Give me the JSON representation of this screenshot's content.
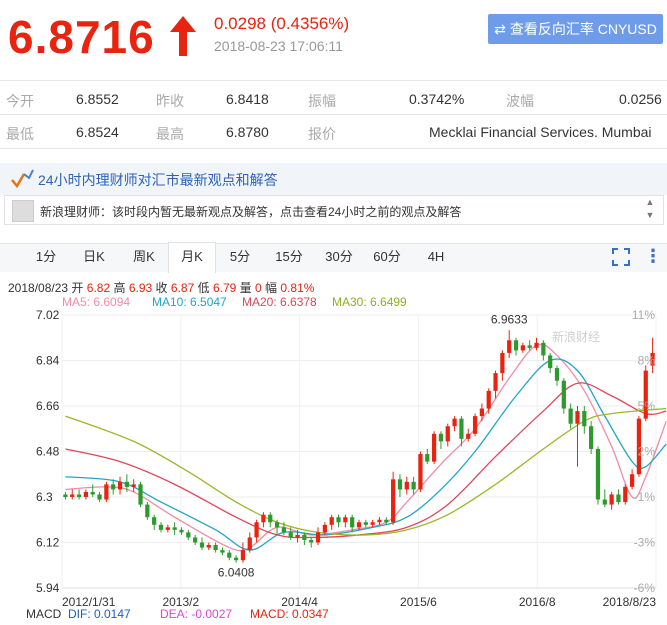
{
  "quote": {
    "price": "6.8716",
    "change": "0.0298 (0.4356%)",
    "datetime": "2018-08-23 17:06:11",
    "reverse_button": "查看反向汇率 CNYUSD",
    "rows": [
      [
        {
          "label": "今开",
          "value": "6.8552"
        },
        {
          "label": "昨收",
          "value": "6.8418"
        },
        {
          "label": "振幅",
          "value": "0.3742%"
        },
        {
          "label": "波幅",
          "value": "0.0256"
        }
      ],
      [
        {
          "label": "最低",
          "value": "6.8524"
        },
        {
          "label": "最高",
          "value": "6.8780"
        },
        {
          "label": "报价",
          "value": "Mecklai Financial Services. Mumbai"
        }
      ]
    ]
  },
  "experts": {
    "title": "24小时内理财师对汇市最新观点和解答",
    "message": "新浪理财师：该时段内暂无最新观点及解答，点击查看24小时之前的观点及解答"
  },
  "tabs": [
    "1分",
    "日K",
    "周K",
    "月K",
    "5分",
    "15分",
    "30分",
    "60分",
    "4H"
  ],
  "active_tab": "月K",
  "kline_info": {
    "date": "2018/08/23",
    "open_label": "开",
    "open": "6.82",
    "high_label": "高",
    "high": "6.93",
    "close_label": "收",
    "close": "6.87",
    "low_label": "低",
    "low": "6.79",
    "vol_label": "量",
    "vol": "0",
    "amp_label": "幅",
    "amp": "0.81%"
  },
  "ma": [
    {
      "label": "MA5: 6.6094",
      "color": "#f08ca6"
    },
    {
      "label": "MA10: 6.5047",
      "color": "#1fa6c6"
    },
    {
      "label": "MA20: 6.6378",
      "color": "#e0455a"
    },
    {
      "label": "MA30: 6.6499",
      "color": "#8db020"
    }
  ],
  "macd": {
    "name": "MACD",
    "dif": "DIF: 0.0147",
    "dea": "DEA: -0.0027",
    "macd": "MACD: 0.0347"
  },
  "chart_data": {
    "type": "candlestick",
    "title": "",
    "watermark": "新浪财经",
    "y_ticks": [
      "7.02",
      "6.84",
      "6.66",
      "6.48",
      "6.3",
      "6.12",
      "5.94"
    ],
    "ylim": [
      5.94,
      7.02
    ],
    "pct_ticks": [
      "11%",
      "8%",
      "5%",
      "2%",
      "-1%",
      "-3%",
      "-6%"
    ],
    "x_ticks": [
      "2012/1/31",
      "2013/2",
      "2014/4",
      "2015/6",
      "2016/8",
      "2018/8/23"
    ],
    "annotations": [
      {
        "text": "6.9633",
        "value": 6.9633
      },
      {
        "text": "6.0408",
        "value": 6.0408
      }
    ],
    "candles": [
      [
        6.31,
        6.3,
        6.32,
        6.29
      ],
      [
        6.3,
        6.31,
        6.33,
        6.29
      ],
      [
        6.31,
        6.3,
        6.33,
        6.29
      ],
      [
        6.3,
        6.32,
        6.33,
        6.29
      ],
      [
        6.32,
        6.31,
        6.35,
        6.3
      ],
      [
        6.31,
        6.29,
        6.32,
        6.28
      ],
      [
        6.29,
        6.35,
        6.36,
        6.28
      ],
      [
        6.35,
        6.33,
        6.37,
        6.31
      ],
      [
        6.33,
        6.36,
        6.38,
        6.31
      ],
      [
        6.36,
        6.34,
        6.39,
        6.32
      ],
      [
        6.34,
        6.35,
        6.37,
        6.32
      ],
      [
        6.35,
        6.27,
        6.36,
        6.26
      ],
      [
        6.27,
        6.22,
        6.28,
        6.21
      ],
      [
        6.22,
        6.19,
        6.23,
        6.17
      ],
      [
        6.19,
        6.17,
        6.2,
        6.16
      ],
      [
        6.17,
        6.18,
        6.19,
        6.16
      ],
      [
        6.18,
        6.17,
        6.2,
        6.15
      ],
      [
        6.17,
        6.16,
        6.18,
        6.15
      ],
      [
        6.16,
        6.14,
        6.17,
        6.13
      ],
      [
        6.14,
        6.12,
        6.15,
        6.11
      ],
      [
        6.12,
        6.1,
        6.14,
        6.09
      ],
      [
        6.1,
        6.11,
        6.12,
        6.09
      ],
      [
        6.11,
        6.09,
        6.12,
        6.08
      ],
      [
        6.09,
        6.08,
        6.1,
        6.07
      ],
      [
        6.08,
        6.06,
        6.09,
        6.05
      ],
      [
        6.06,
        6.05,
        6.07,
        6.04
      ],
      [
        6.05,
        6.09,
        6.12,
        6.04
      ],
      [
        6.09,
        6.14,
        6.16,
        6.08
      ],
      [
        6.14,
        6.2,
        6.21,
        6.12
      ],
      [
        6.2,
        6.23,
        6.24,
        6.18
      ],
      [
        6.23,
        6.2,
        6.24,
        6.18
      ],
      [
        6.2,
        6.18,
        6.21,
        6.15
      ],
      [
        6.18,
        6.16,
        6.2,
        6.15
      ],
      [
        6.16,
        6.14,
        6.18,
        6.13
      ],
      [
        6.14,
        6.15,
        6.17,
        6.12
      ],
      [
        6.15,
        6.13,
        6.16,
        6.11
      ],
      [
        6.13,
        6.12,
        6.14,
        6.1
      ],
      [
        6.12,
        6.16,
        6.18,
        6.11
      ],
      [
        6.16,
        6.19,
        6.2,
        6.15
      ],
      [
        6.19,
        6.22,
        6.23,
        6.17
      ],
      [
        6.22,
        6.2,
        6.23,
        6.18
      ],
      [
        6.2,
        6.22,
        6.23,
        6.18
      ],
      [
        6.22,
        6.18,
        6.23,
        6.16
      ],
      [
        6.18,
        6.2,
        6.21,
        6.17
      ],
      [
        6.2,
        6.19,
        6.21,
        6.18
      ],
      [
        6.19,
        6.2,
        6.21,
        6.18
      ],
      [
        6.2,
        6.21,
        6.22,
        6.19
      ],
      [
        6.21,
        6.2,
        6.22,
        6.19
      ],
      [
        6.2,
        6.37,
        6.4,
        6.19
      ],
      [
        6.37,
        6.33,
        6.39,
        6.3
      ],
      [
        6.33,
        6.36,
        6.38,
        6.31
      ],
      [
        6.36,
        6.33,
        6.38,
        6.31
      ],
      [
        6.33,
        6.47,
        6.48,
        6.32
      ],
      [
        6.47,
        6.44,
        6.49,
        6.43
      ],
      [
        6.44,
        6.55,
        6.56,
        6.43
      ],
      [
        6.55,
        6.52,
        6.56,
        6.49
      ],
      [
        6.52,
        6.58,
        6.59,
        6.5
      ],
      [
        6.58,
        6.61,
        6.62,
        6.56
      ],
      [
        6.61,
        6.53,
        6.62,
        6.5
      ],
      [
        6.53,
        6.55,
        6.57,
        6.52
      ],
      [
        6.55,
        6.62,
        6.63,
        6.54
      ],
      [
        6.62,
        6.65,
        6.67,
        6.6
      ],
      [
        6.65,
        6.72,
        6.73,
        6.63
      ],
      [
        6.72,
        6.79,
        6.8,
        6.69
      ],
      [
        6.79,
        6.87,
        6.88,
        6.76
      ],
      [
        6.87,
        6.92,
        6.96,
        6.85
      ],
      [
        6.92,
        6.88,
        6.93,
        6.86
      ],
      [
        6.88,
        6.9,
        6.91,
        6.87
      ],
      [
        6.9,
        6.89,
        6.92,
        6.88
      ],
      [
        6.89,
        6.91,
        6.93,
        6.88
      ],
      [
        6.91,
        6.86,
        6.92,
        6.84
      ],
      [
        6.86,
        6.81,
        6.87,
        6.79
      ],
      [
        6.81,
        6.76,
        6.82,
        6.74
      ],
      [
        6.76,
        6.65,
        6.77,
        6.63
      ],
      [
        6.65,
        6.59,
        6.67,
        6.57
      ],
      [
        6.59,
        6.64,
        6.66,
        6.42
      ],
      [
        6.64,
        6.58,
        6.66,
        6.55
      ],
      [
        6.58,
        6.49,
        6.6,
        6.47
      ],
      [
        6.49,
        6.29,
        6.5,
        6.27
      ],
      [
        6.29,
        6.27,
        6.33,
        6.26
      ],
      [
        6.27,
        6.31,
        6.32,
        6.25
      ],
      [
        6.31,
        6.28,
        6.33,
        6.27
      ],
      [
        6.28,
        6.34,
        6.35,
        6.27
      ],
      [
        6.34,
        6.39,
        6.41,
        6.33
      ],
      [
        6.39,
        6.61,
        6.62,
        6.38
      ],
      [
        6.61,
        6.8,
        6.82,
        6.6
      ],
      [
        6.82,
        6.87,
        6.93,
        6.79
      ]
    ],
    "ma_series": [
      {
        "name": "MA5",
        "color": "#f08ca6",
        "anchors": [
          [
            0,
            6.33
          ],
          [
            6,
            6.34
          ],
          [
            10,
            6.32
          ],
          [
            16,
            6.22
          ],
          [
            24,
            6.1
          ],
          [
            27,
            6.1
          ],
          [
            31,
            6.18
          ],
          [
            36,
            6.15
          ],
          [
            42,
            6.17
          ],
          [
            47,
            6.2
          ],
          [
            50,
            6.28
          ],
          [
            55,
            6.43
          ],
          [
            60,
            6.57
          ],
          [
            65,
            6.77
          ],
          [
            69,
            6.9
          ],
          [
            72,
            6.86
          ],
          [
            76,
            6.72
          ],
          [
            80,
            6.5
          ],
          [
            83,
            6.3
          ],
          [
            85,
            6.38
          ],
          [
            88,
            6.6
          ]
        ]
      },
      {
        "name": "MA10",
        "color": "#1fa6c6",
        "anchors": [
          [
            0,
            6.38
          ],
          [
            8,
            6.36
          ],
          [
            14,
            6.28
          ],
          [
            22,
            6.17
          ],
          [
            27,
            6.09
          ],
          [
            32,
            6.16
          ],
          [
            38,
            6.15
          ],
          [
            45,
            6.18
          ],
          [
            50,
            6.22
          ],
          [
            55,
            6.33
          ],
          [
            60,
            6.48
          ],
          [
            66,
            6.7
          ],
          [
            71,
            6.84
          ],
          [
            75,
            6.8
          ],
          [
            79,
            6.62
          ],
          [
            83,
            6.44
          ],
          [
            85,
            6.42
          ],
          [
            88,
            6.51
          ]
        ]
      },
      {
        "name": "MA20",
        "color": "#e0455a",
        "anchors": [
          [
            0,
            6.49
          ],
          [
            8,
            6.44
          ],
          [
            16,
            6.35
          ],
          [
            25,
            6.22
          ],
          [
            31,
            6.15
          ],
          [
            36,
            6.14
          ],
          [
            43,
            6.15
          ],
          [
            50,
            6.18
          ],
          [
            56,
            6.27
          ],
          [
            63,
            6.46
          ],
          [
            70,
            6.64
          ],
          [
            75,
            6.75
          ],
          [
            80,
            6.7
          ],
          [
            85,
            6.63
          ],
          [
            88,
            6.64
          ]
        ]
      },
      {
        "name": "MA30",
        "color": "#9ab82a",
        "anchors": [
          [
            0,
            6.62
          ],
          [
            10,
            6.52
          ],
          [
            18,
            6.4
          ],
          [
            25,
            6.28
          ],
          [
            31,
            6.2
          ],
          [
            37,
            6.16
          ],
          [
            44,
            6.15
          ],
          [
            50,
            6.17
          ],
          [
            56,
            6.23
          ],
          [
            63,
            6.35
          ],
          [
            70,
            6.49
          ],
          [
            76,
            6.6
          ],
          [
            80,
            6.63
          ],
          [
            88,
            6.65
          ]
        ]
      }
    ]
  }
}
